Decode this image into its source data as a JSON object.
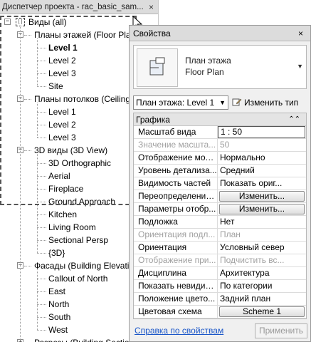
{
  "project_browser": {
    "title": "Диспетчер проекта - rac_basic_sam...",
    "close_glyph": "×",
    "tree": [
      {
        "label": "Виды (all)",
        "level": 0,
        "toggle": "−",
        "icon": "views-icon"
      },
      {
        "label": "Планы этажей (Floor Pla",
        "level": 1,
        "toggle": "−"
      },
      {
        "label": "Level 1",
        "level": 2,
        "bold": true
      },
      {
        "label": "Level 2",
        "level": 2
      },
      {
        "label": "Level 3",
        "level": 2
      },
      {
        "label": "Site",
        "level": 2
      },
      {
        "label": "Планы потолков (Ceiling",
        "level": 1,
        "toggle": "−"
      },
      {
        "label": "Level 1",
        "level": 2
      },
      {
        "label": "Level 2",
        "level": 2
      },
      {
        "label": "Level 3",
        "level": 2
      },
      {
        "label": "3D виды (3D View)",
        "level": 1,
        "toggle": "−"
      },
      {
        "label": "3D Orthographic",
        "level": 2
      },
      {
        "label": "Aerial",
        "level": 2
      },
      {
        "label": "Fireplace",
        "level": 2
      },
      {
        "label": "Ground Approach",
        "level": 2
      },
      {
        "label": "Kitchen",
        "level": 2
      },
      {
        "label": "Living Room",
        "level": 2
      },
      {
        "label": "Sectional Persp",
        "level": 2
      },
      {
        "label": "{3D}",
        "level": 2
      },
      {
        "label": "Фасады (Building Elevati",
        "level": 1,
        "toggle": "−"
      },
      {
        "label": "Callout of North",
        "level": 2
      },
      {
        "label": "East",
        "level": 2
      },
      {
        "label": "North",
        "level": 2
      },
      {
        "label": "South",
        "level": 2
      },
      {
        "label": "West",
        "level": 2
      },
      {
        "label": "Разрезы (Building Sectio",
        "level": 1,
        "toggle": "+"
      }
    ]
  },
  "properties": {
    "title": "Свойства",
    "close_glyph": "×",
    "type_selector": {
      "line1": "План этажа",
      "line2": "Floor Plan"
    },
    "instance_selector": "План этажа: Level 1",
    "edit_type_label": "Изменить тип",
    "group_header": "Графика",
    "rows": [
      {
        "key": "Масштаб вида",
        "value": "1 : 50",
        "kind": "input"
      },
      {
        "key": "Значение масшта...",
        "value": "50",
        "kind": "dim"
      },
      {
        "key": "Отображение мод...",
        "value": "Нормально"
      },
      {
        "key": "Уровень детализа...",
        "value": "Средний"
      },
      {
        "key": "Видимость частей",
        "value": "Показать ориг..."
      },
      {
        "key": "Переопределения...",
        "value": "Изменить...",
        "kind": "button"
      },
      {
        "key": "Параметры отобр...",
        "value": "Изменить...",
        "kind": "button"
      },
      {
        "key": "Подложка",
        "value": "Нет"
      },
      {
        "key": "Ориентация подл...",
        "value": "План",
        "kind": "dim"
      },
      {
        "key": "Ориентация",
        "value": "Условный север"
      },
      {
        "key": "Отображение при...",
        "value": "Подчистить вс...",
        "kind": "dim"
      },
      {
        "key": "Дисциплина",
        "value": "Архитектура"
      },
      {
        "key": "Показать невидим...",
        "value": "По категории"
      },
      {
        "key": "Положение цвето...",
        "value": "Задний план"
      },
      {
        "key": "Цветовая схема",
        "value": "Scheme 1",
        "kind": "button"
      }
    ],
    "help_link": "Справка по свойствам",
    "apply_label": "Применить"
  }
}
